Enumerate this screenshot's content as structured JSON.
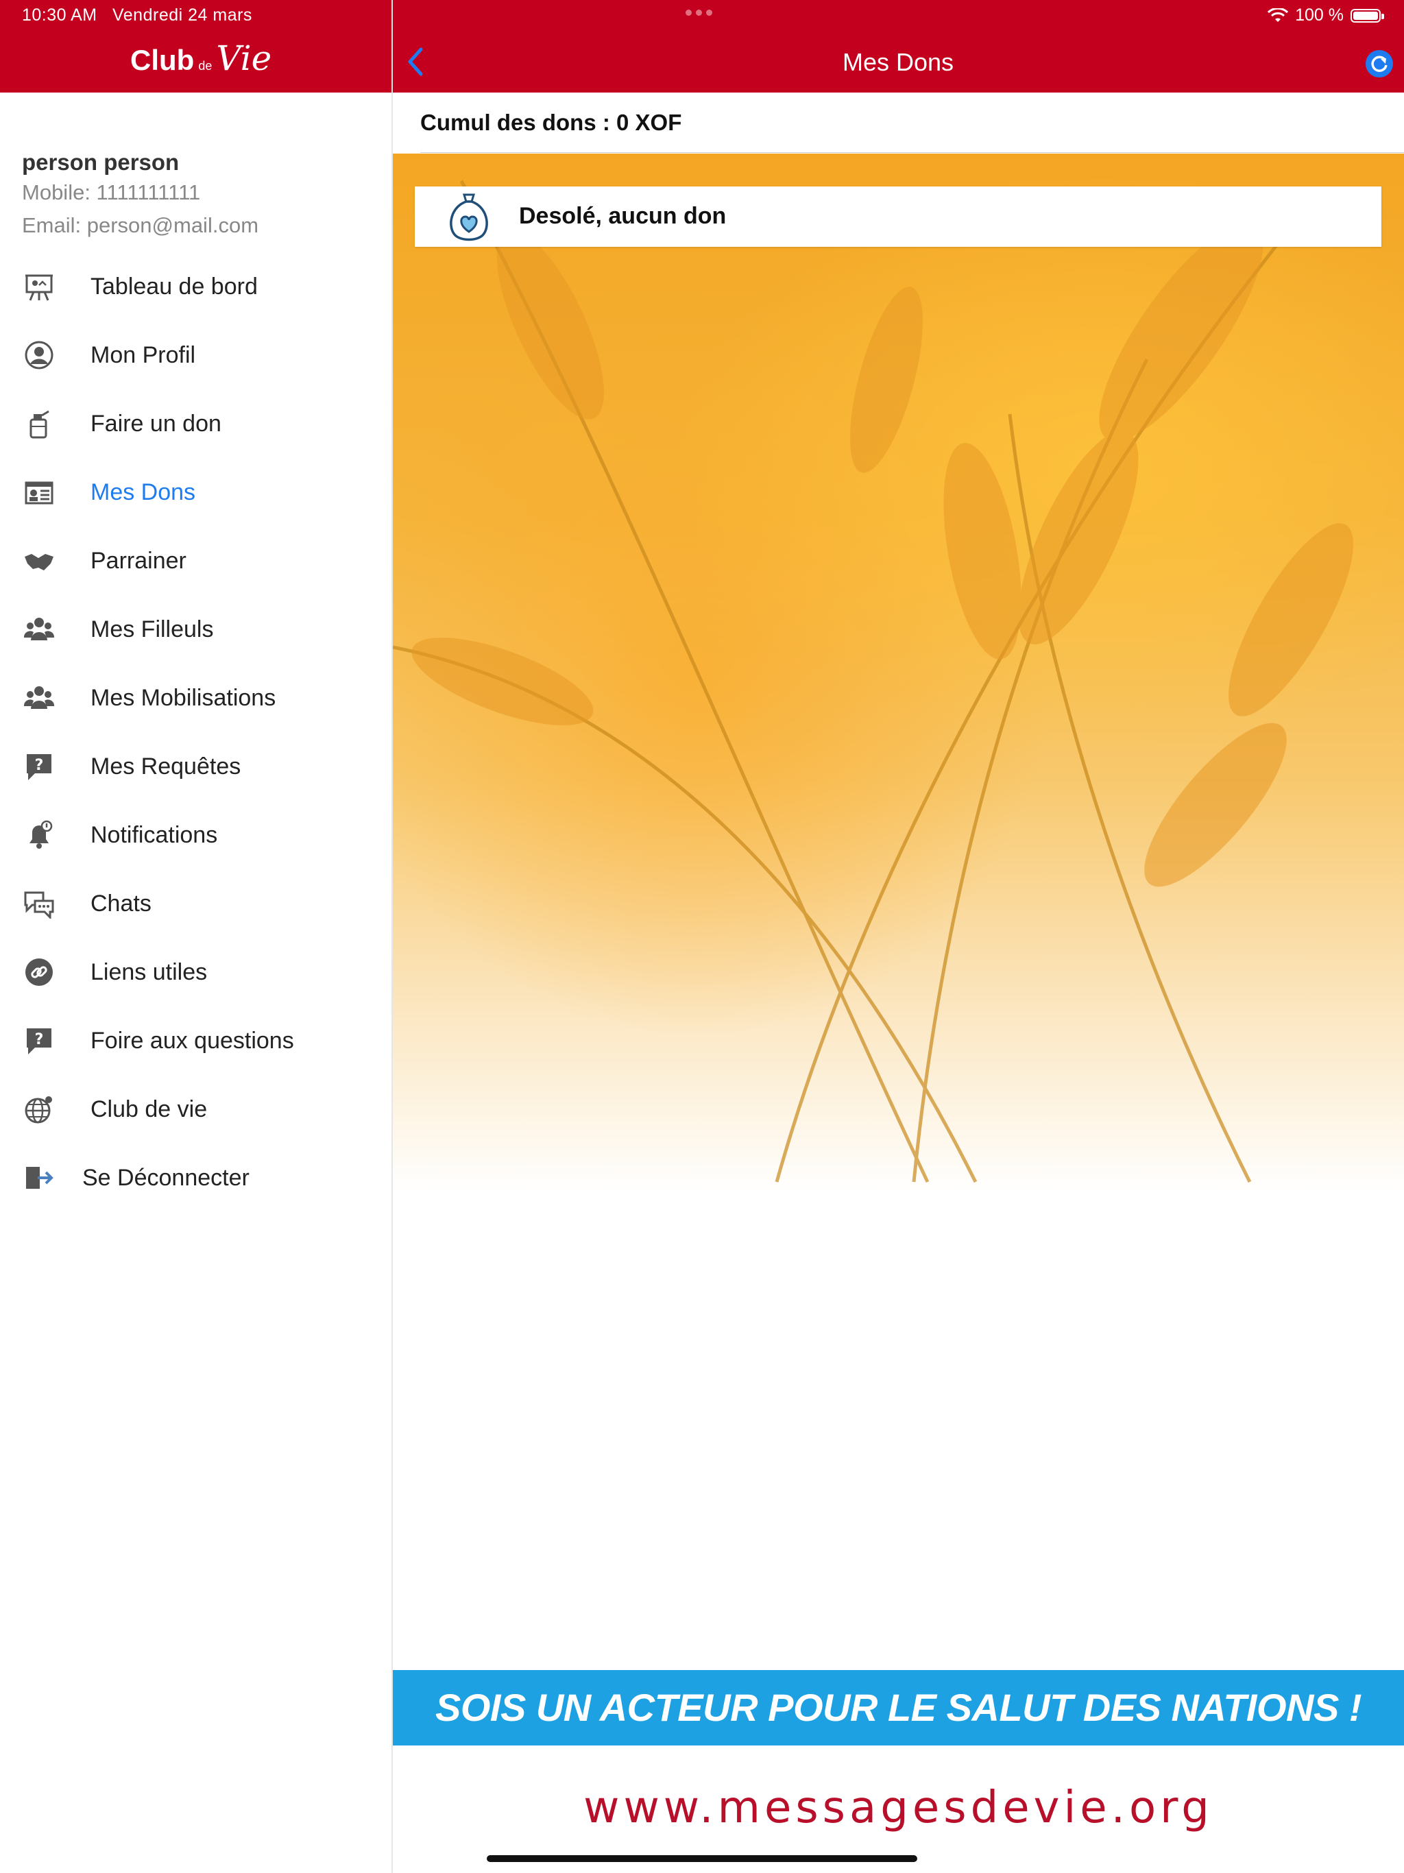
{
  "status": {
    "time": "10:30 AM",
    "date": "Vendredi 24 mars",
    "battery": "100 %"
  },
  "logo": {
    "club": "Club",
    "de": "de",
    "vie": "Vie"
  },
  "nav": {
    "title": "Mes Dons"
  },
  "user": {
    "name": "person person",
    "mobile": "Mobile: 1111111111",
    "email": "Email: person@mail.com"
  },
  "menu": [
    {
      "label": "Tableau de bord",
      "icon": "presentation-board-icon"
    },
    {
      "label": "Mon Profil",
      "icon": "user-circle-icon"
    },
    {
      "label": "Faire un don",
      "icon": "donation-bottle-icon"
    },
    {
      "label": "Mes Dons",
      "icon": "id-card-icon",
      "active": true
    },
    {
      "label": "Parrainer",
      "icon": "handshake-icon"
    },
    {
      "label": "Mes Filleuls",
      "icon": "group-icon"
    },
    {
      "label": "Mes Mobilisations",
      "icon": "group-icon"
    },
    {
      "label": "Mes Requêtes",
      "icon": "question-bubble-icon"
    },
    {
      "label": "Notifications",
      "icon": "bell-icon"
    },
    {
      "label": "Chats",
      "icon": "chat-bubbles-icon"
    },
    {
      "label": "Liens utiles",
      "icon": "link-icon"
    },
    {
      "label": "Foire aux questions",
      "icon": "question-bubble-icon"
    },
    {
      "label": "Club de vie",
      "icon": "globe-icon"
    },
    {
      "label": "Se Déconnecter",
      "icon": "logout-icon"
    }
  ],
  "main": {
    "cumul": "Cumul des dons : 0 XOF",
    "empty": "Desolé, aucun don"
  },
  "banner": {
    "text": "SOIS UN ACTEUR POUR LE SALUT DES NATIONS !",
    "url": "www.messagesdevie.org"
  },
  "colors": {
    "brand_red": "#c4001f",
    "accent_blue": "#1e7cf0",
    "banner_blue": "#1da1e2"
  }
}
